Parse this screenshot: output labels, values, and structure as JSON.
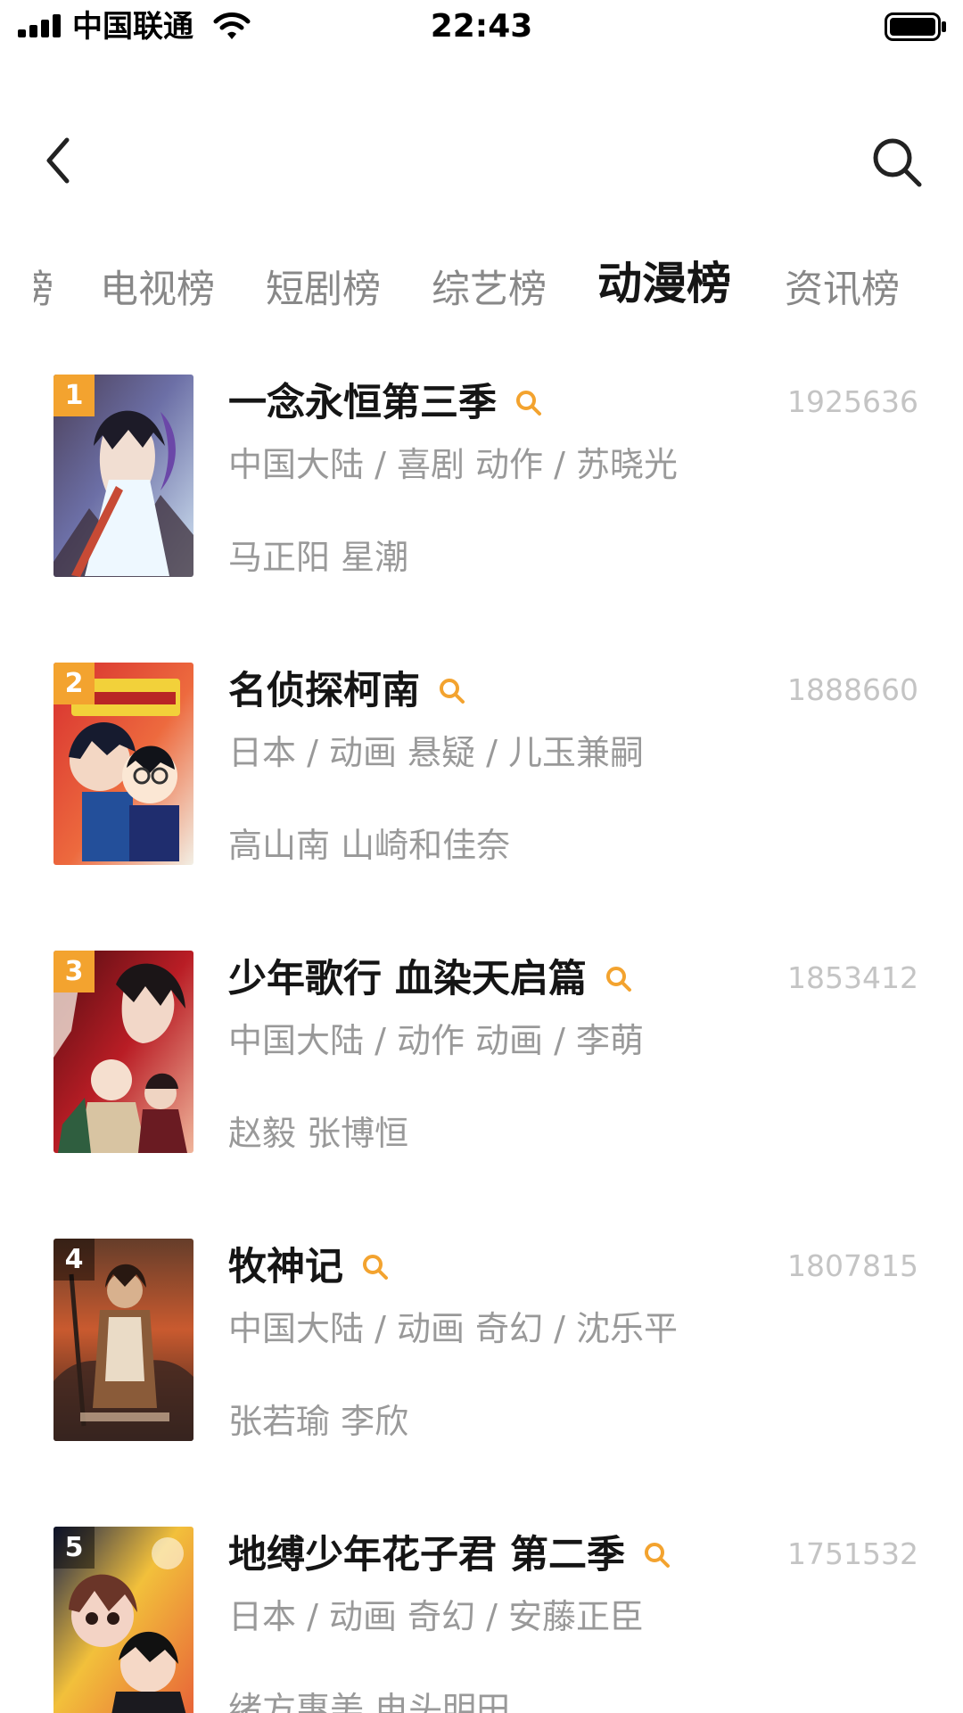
{
  "status_bar": {
    "carrier": "中国联通",
    "time": "22:43"
  },
  "header": {
    "back_icon": "chevron-left-icon",
    "search_icon": "search-icon"
  },
  "tabs": [
    {
      "label": "榜",
      "active": false,
      "partial": true
    },
    {
      "label": "电视榜",
      "active": false
    },
    {
      "label": "短剧榜",
      "active": false
    },
    {
      "label": "综艺榜",
      "active": false
    },
    {
      "label": "动漫榜",
      "active": true
    },
    {
      "label": "资讯榜",
      "active": false
    }
  ],
  "items": [
    {
      "rank": "1",
      "title": "一念永恒第三季",
      "heat": "1925636",
      "meta": "中国大陆 / 喜剧 动作 / 苏晓光",
      "cast": "马正阳 星潮"
    },
    {
      "rank": "2",
      "title": "名侦探柯南",
      "heat": "1888660",
      "meta": "日本 / 动画 悬疑 / 儿玉兼嗣",
      "cast": "高山南 山崎和佳奈"
    },
    {
      "rank": "3",
      "title": "少年歌行 血染天启篇",
      "heat": "1853412",
      "meta": "中国大陆 / 动作 动画 / 李萌",
      "cast": "赵毅 张博恒"
    },
    {
      "rank": "4",
      "title": "牧神记",
      "heat": "1807815",
      "meta": "中国大陆 / 动画 奇幻 / 沈乐平",
      "cast": "张若瑜 李欣"
    },
    {
      "rank": "5",
      "title": "地缚少年花子君 第二季",
      "heat": "1751532",
      "meta": "日本 / 动画 奇幻 / 安藤正臣",
      "cast": "绪方惠美 电头明田"
    }
  ],
  "colors": {
    "accent": "#f3a32f",
    "primary_text": "#151515",
    "secondary_text": "#999999",
    "heat_text": "#c4c4c4"
  }
}
